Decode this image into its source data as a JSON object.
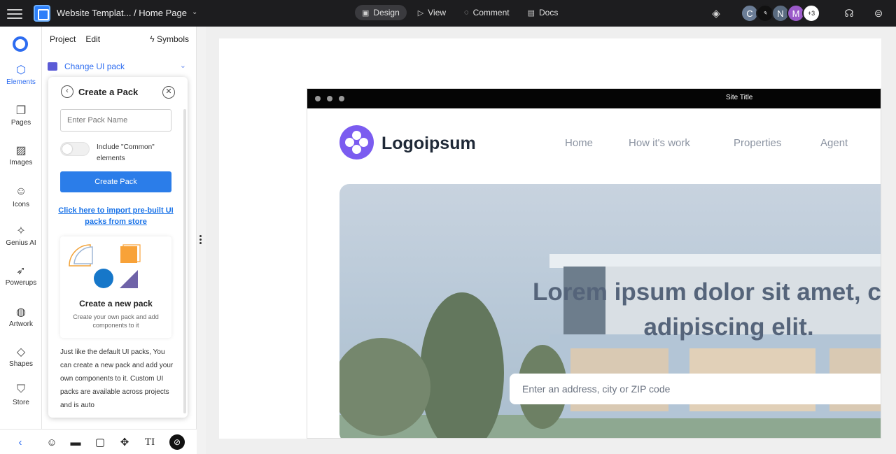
{
  "topbar": {
    "title": "Website Templat... / Home Page",
    "tabs": [
      {
        "label": "Design",
        "icon": "layout-icon",
        "active": true
      },
      {
        "label": "View",
        "icon": "play-icon",
        "active": false
      },
      {
        "label": "Comment",
        "icon": "comment-icon",
        "active": false
      },
      {
        "label": "Docs",
        "icon": "doc-icon",
        "active": false
      }
    ],
    "avatars": [
      {
        "text": "C",
        "color": "#6b7d96"
      },
      {
        "text": "",
        "color": "#111111"
      },
      {
        "text": "N",
        "color": "#5a6b80"
      },
      {
        "text": "M",
        "color": "#9b5ac9"
      },
      {
        "text": "+3",
        "color": "#ffffff"
      }
    ]
  },
  "rail": {
    "items": [
      {
        "label": "Elements",
        "icon": "cube-icon",
        "active": true
      },
      {
        "label": "Pages",
        "icon": "pages-icon"
      },
      {
        "label": "Images",
        "icon": "image-icon"
      },
      {
        "label": "Icons",
        "icon": "smiley-icon"
      },
      {
        "label": "Genius AI",
        "icon": "sparkle-icon"
      },
      {
        "label": "Powerups",
        "icon": "rocket-icon"
      },
      {
        "label": "Artwork",
        "icon": "globe-icon"
      },
      {
        "label": "Shapes",
        "icon": "diamond-icon"
      },
      {
        "label": "Store",
        "icon": "bag-icon"
      }
    ]
  },
  "panel": {
    "tab_project": "Project",
    "tab_edit": "Edit",
    "symbols": "Symbols",
    "ui_pack": "Change UI pack"
  },
  "popup": {
    "title": "Create a Pack",
    "input_placeholder": "Enter Pack Name",
    "toggle_label": "Include \"Common\" elements",
    "toggle_on": false,
    "create_button": "Create Pack",
    "import_link": "Click here to import pre-built UI packs from store",
    "card_title": "Create a new pack",
    "card_subtitle": "Create your own pack and add components to it",
    "description": "Just like the default UI packs, You can create a new pack and add your own components to it. Custom UI packs are available across projects and is auto"
  },
  "canvas": {
    "site_title": "Site Title",
    "logo_text": "Logoipsum",
    "nav": [
      "Home",
      "How it's work",
      "Properties",
      "Agent"
    ],
    "hero_line1": "Lorem ipsum dolor sit amet, cons",
    "hero_line2": "adipiscing elit.",
    "search_placeholder": "Enter an address, city or ZIP code"
  },
  "colors": {
    "accent": "#2b7de9",
    "logo_purple": "#7b5cf0",
    "topbar_bg": "#1d1d1f"
  }
}
